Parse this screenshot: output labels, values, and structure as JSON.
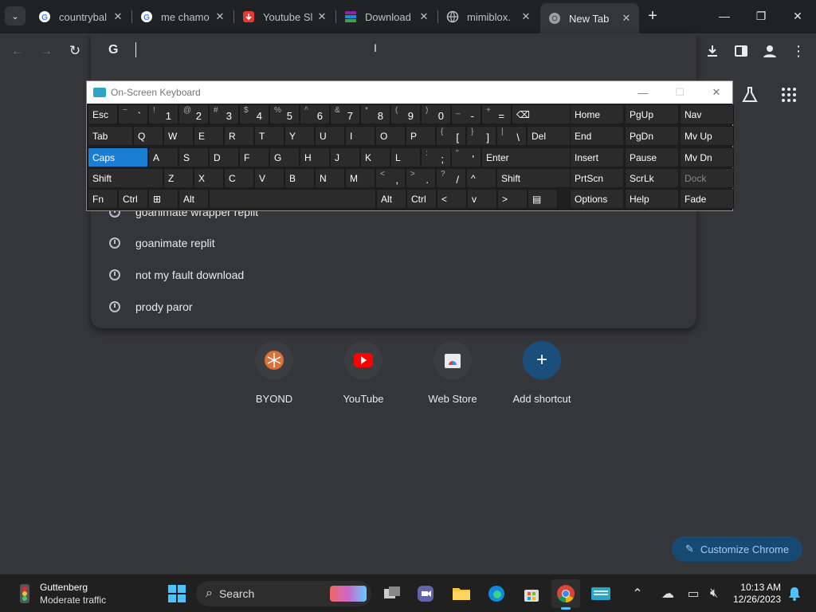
{
  "tabs": [
    {
      "title": "countrybal",
      "favicon": "google-icon"
    },
    {
      "title": "me chamo",
      "favicon": "google-icon"
    },
    {
      "title": "Youtube Sl",
      "favicon": "download-red-icon"
    },
    {
      "title": "Download",
      "favicon": "winrar-icon"
    },
    {
      "title": "mimiblox.",
      "favicon": "globe-icon"
    },
    {
      "title": "New Tab",
      "favicon": "chrome-icon",
      "active": true
    }
  ],
  "omnibox": {
    "value": "",
    "suggestions": [
      "goanimate wrapper replit",
      "goanimate replit",
      "not my fault download",
      "prody paror"
    ]
  },
  "osk": {
    "title": "On-Screen Keyboard",
    "row1": [
      {
        "m": "Esc"
      },
      {
        "s": "~",
        "d": "`"
      },
      {
        "s": "!",
        "d": "1"
      },
      {
        "s": "@",
        "d": "2"
      },
      {
        "s": "#",
        "d": "3"
      },
      {
        "s": "$",
        "d": "4"
      },
      {
        "s": "%",
        "d": "5"
      },
      {
        "s": "^",
        "d": "6"
      },
      {
        "s": "&",
        "d": "7"
      },
      {
        "s": "*",
        "d": "8"
      },
      {
        "s": "(",
        "d": "9"
      },
      {
        "s": ")",
        "d": "0"
      },
      {
        "s": "_",
        "d": "-"
      },
      {
        "s": "+",
        "d": "="
      },
      {
        "m": "⌫"
      }
    ],
    "row2": [
      {
        "m": "Tab"
      },
      {
        "m": "Q"
      },
      {
        "m": "W"
      },
      {
        "m": "E"
      },
      {
        "m": "R"
      },
      {
        "m": "T"
      },
      {
        "m": "Y"
      },
      {
        "m": "U"
      },
      {
        "m": "I"
      },
      {
        "m": "O"
      },
      {
        "m": "P"
      },
      {
        "s": "{",
        "d": "["
      },
      {
        "s": "}",
        "d": "]"
      },
      {
        "s": "|",
        "d": "\\"
      },
      {
        "m": "Del"
      }
    ],
    "row3": [
      {
        "m": "Caps"
      },
      {
        "m": "A"
      },
      {
        "m": "S"
      },
      {
        "m": "D"
      },
      {
        "m": "F"
      },
      {
        "m": "G"
      },
      {
        "m": "H"
      },
      {
        "m": "J"
      },
      {
        "m": "K"
      },
      {
        "m": "L"
      },
      {
        "s": ":",
        "d": ";"
      },
      {
        "s": "\"",
        "d": "'"
      },
      {
        "m": "Enter"
      }
    ],
    "row4": [
      {
        "m": "Shift"
      },
      {
        "m": "Z"
      },
      {
        "m": "X"
      },
      {
        "m": "C"
      },
      {
        "m": "V"
      },
      {
        "m": "B"
      },
      {
        "m": "N"
      },
      {
        "m": "M"
      },
      {
        "s": "<",
        "d": ","
      },
      {
        "s": ">",
        "d": "."
      },
      {
        "s": "?",
        "d": "/"
      },
      {
        "m": "^"
      },
      {
        "m": "Shift"
      }
    ],
    "row5": [
      {
        "m": "Fn"
      },
      {
        "m": "Ctrl"
      },
      {
        "m": "⊞"
      },
      {
        "m": "Alt"
      },
      {
        "m": ""
      },
      {
        "m": "Alt"
      },
      {
        "m": "Ctrl"
      },
      {
        "m": "<"
      },
      {
        "m": "v"
      },
      {
        "m": ">"
      },
      {
        "m": "▤"
      }
    ],
    "nav": [
      [
        "Home",
        "PgUp",
        "Nav"
      ],
      [
        "End",
        "PgDn",
        "Mv Up"
      ],
      [
        "Insert",
        "Pause",
        "Mv Dn"
      ],
      [
        "PrtScn",
        "ScrLk",
        "Dock"
      ],
      [
        "Options",
        "Help",
        "Fade"
      ]
    ]
  },
  "shortcuts": [
    {
      "label": "BYOND",
      "icon": "byond-icon"
    },
    {
      "label": "YouTube",
      "icon": "youtube-icon"
    },
    {
      "label": "Web Store",
      "icon": "webstore-icon"
    },
    {
      "label": "Add shortcut",
      "icon": "plus-icon"
    }
  ],
  "customize_label": "Customize Chrome",
  "taskbar": {
    "weather_title": "Guttenberg",
    "weather_sub": "Moderate traffic",
    "search_label": "Search",
    "time": "10:13 AM",
    "date": "12/26/2023"
  },
  "colors": {
    "accent": "#1a7fd4",
    "chrome_bg": "#35363a",
    "tabstrip": "#202124"
  }
}
